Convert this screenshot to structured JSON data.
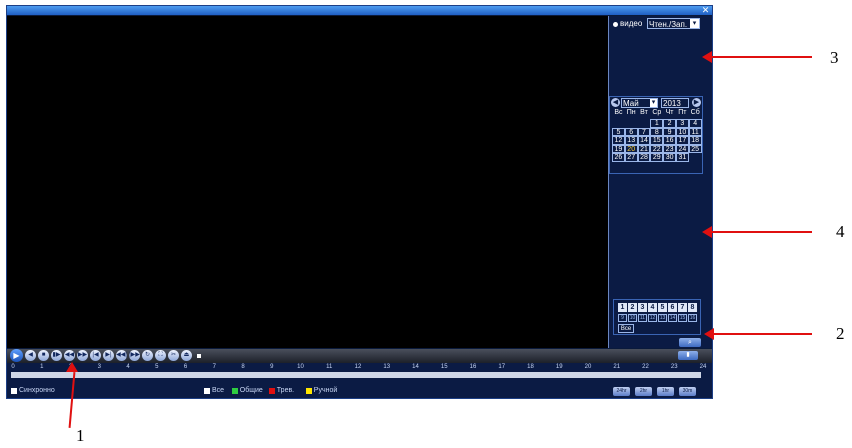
{
  "window": {
    "close_icon": "close-icon"
  },
  "side_panel": {
    "mode_label": "видео",
    "mode_select": "Чтен./Зап.",
    "calendar": {
      "month": "Май",
      "year": "2013",
      "weekdays": [
        "Вс",
        "Пн",
        "Вт",
        "Ср",
        "Чт",
        "Пт",
        "Сб"
      ],
      "days": [
        "",
        "",
        "",
        "1",
        "2",
        "3",
        "4",
        "5",
        "6",
        "7",
        "8",
        "9",
        "10",
        "11",
        "12",
        "13",
        "14",
        "15",
        "16",
        "17",
        "18",
        "19",
        "20",
        "21",
        "22",
        "23",
        "24",
        "25",
        "26",
        "27",
        "28",
        "29",
        "30",
        "31",
        "",
        "",
        ""
      ],
      "days_with_records": [
        "1",
        "2",
        "3",
        "4",
        "5",
        "6",
        "7",
        "8",
        "9",
        "10",
        "11",
        "12",
        "13",
        "14",
        "15",
        "16",
        "17",
        "18",
        "19",
        "20",
        "21",
        "22",
        "23",
        "24",
        "25",
        "26",
        "27",
        "28",
        "29",
        "30",
        "31"
      ],
      "highlighted_day": "20"
    },
    "channels": {
      "primary": [
        "1",
        "2",
        "3",
        "4",
        "5",
        "6",
        "7",
        "8"
      ],
      "secondary": [
        "9",
        "10",
        "11",
        "12",
        "13",
        "14",
        "15",
        "16"
      ],
      "all_label": "Все"
    },
    "search_icon": "search-icon"
  },
  "playback_controls": {
    "buttons": [
      "play-icon",
      "rewind-icon",
      "stop-icon",
      "step-back-icon",
      "slow-icon",
      "fast-forward-icon",
      "prev-frame-icon",
      "next-frame-icon",
      "prev-file-icon",
      "next-file-icon",
      "loop-icon",
      "fullscreen-icon",
      "cut-icon",
      "backup-icon"
    ]
  },
  "timeline": {
    "hours": [
      "0",
      "1",
      "2",
      "3",
      "4",
      "5",
      "6",
      "7",
      "8",
      "9",
      "10",
      "11",
      "12",
      "13",
      "14",
      "15",
      "16",
      "17",
      "18",
      "19",
      "20",
      "21",
      "22",
      "23",
      "24"
    ]
  },
  "bottom": {
    "sync_label": "Синхронно",
    "legend": [
      {
        "label": "Все",
        "color": "#ffffff"
      },
      {
        "label": "Общие",
        "color": "#2ecc40"
      },
      {
        "label": "Трев.",
        "color": "#e01010"
      },
      {
        "label": "Ручной",
        "color": "#ffe600"
      }
    ],
    "zoom_buttons": [
      "24hr",
      "2hr",
      "1hr",
      "30m"
    ]
  },
  "callouts": [
    "3",
    "4",
    "2",
    "1"
  ],
  "colors": {
    "annotation_arrow": "#e01010",
    "frame": "#1d3f86"
  }
}
